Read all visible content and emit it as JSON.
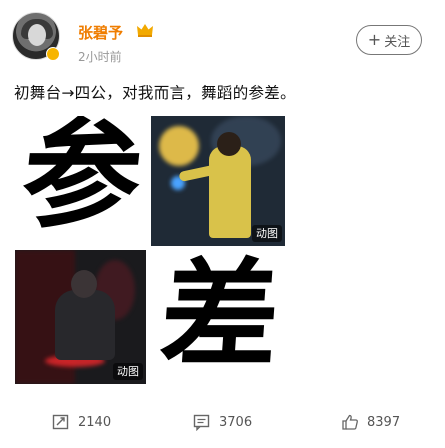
{
  "post": {
    "username": "张碧予",
    "timestamp": "2小时前",
    "follow_label": "关注",
    "text": "初舞台→四公，对我而言，舞蹈的参差。"
  },
  "media": [
    {
      "kind": "text",
      "char": "参"
    },
    {
      "kind": "animated",
      "badge": "动图"
    },
    {
      "kind": "animated",
      "badge": "动图"
    },
    {
      "kind": "text",
      "char": "差"
    }
  ],
  "actions": {
    "repost_count": "2140",
    "comment_count": "3706",
    "like_count": "8397"
  },
  "colors": {
    "username": "#ef7d00",
    "verified": "#f7b500"
  },
  "icons": [
    "crown-icon",
    "verified-icon",
    "repost-icon",
    "comment-icon",
    "like-icon"
  ]
}
